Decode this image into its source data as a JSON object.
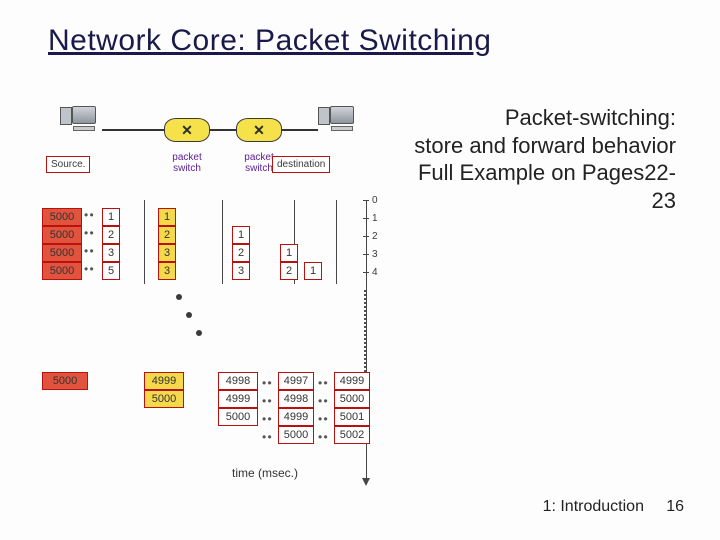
{
  "title": "Network Core: Packet Switching",
  "right": {
    "l1": "Packet-switching:",
    "l2": "store and forward behavior",
    "l3": "Full Example on Pages22-23"
  },
  "top": {
    "source_label": "Source.",
    "packet_switch_label": "packet switch",
    "destination_label": "destination"
  },
  "axis_right": {
    "t0": "0",
    "t1": "1",
    "t2": "2",
    "t3": "3",
    "t4": "4"
  },
  "col0": {
    "r1": {
      "a": "5000",
      "b": "1"
    },
    "r2": {
      "a": "5000",
      "b": "2"
    },
    "r3": {
      "a": "5000",
      "b": "3"
    },
    "r4": {
      "a": "5000",
      "b": "5"
    },
    "low": "5000"
  },
  "col1": {
    "n1": "1",
    "n2": "2",
    "n3": "3",
    "n4": "3",
    "low1": "4999",
    "low2": "5000"
  },
  "col2": {
    "n1": "1",
    "n2": "2",
    "n3": "3",
    "low1": "4998",
    "low2": "4999",
    "low3": "5000"
  },
  "col3": {
    "n1": "1",
    "n2": "2",
    "low1": "4997",
    "low2": "4998",
    "low3": "4999",
    "low4": "5000"
  },
  "col3b": {
    "n1": "1",
    "low1": "4999",
    "low2": "5000",
    "low3": "5001",
    "low4": "5002"
  },
  "time_label": "time  (msec.)",
  "footer": {
    "section": "1: Introduction",
    "page": "16"
  }
}
